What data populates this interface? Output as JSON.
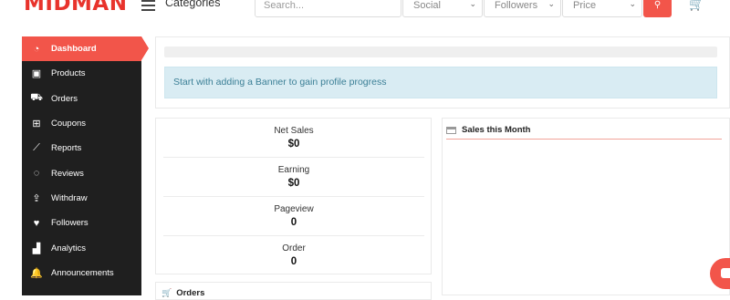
{
  "header": {
    "logo": "MIDMAN",
    "categories_label": "Categories",
    "search_placeholder": "Search...",
    "filters": [
      {
        "label": "Social"
      },
      {
        "label": "Followers"
      },
      {
        "label": "Price"
      }
    ],
    "search_icon": "search-icon",
    "cart_icon": "cart-icon"
  },
  "sidebar": {
    "items": [
      {
        "label": "Dashboard",
        "icon": "dashboard-icon",
        "active": true
      },
      {
        "label": "Products",
        "icon": "briefcase-icon"
      },
      {
        "label": "Orders",
        "icon": "cart-icon"
      },
      {
        "label": "Coupons",
        "icon": "gift-icon"
      },
      {
        "label": "Reports",
        "icon": "chart-line-icon"
      },
      {
        "label": "Reviews",
        "icon": "comments-icon"
      },
      {
        "label": "Withdraw",
        "icon": "upload-icon"
      },
      {
        "label": "Followers",
        "icon": "heart-icon"
      },
      {
        "label": "Analytics",
        "icon": "chart-area-icon"
      },
      {
        "label": "Announcements",
        "icon": "bell-icon"
      }
    ]
  },
  "profile_progress": {
    "progress": 0,
    "banner": "Start with adding a Banner to gain profile progress"
  },
  "stats": [
    {
      "label": "Net Sales",
      "value": "$0"
    },
    {
      "label": "Earning",
      "value": "$0"
    },
    {
      "label": "Pageview",
      "value": "0"
    },
    {
      "label": "Order",
      "value": "0"
    }
  ],
  "sales_panel": {
    "title": "Sales this Month"
  },
  "orders_panel": {
    "title": "Orders"
  },
  "colors": {
    "accent": "#f2554a",
    "sidebar_bg": "#1f1f1f",
    "info_bg": "#d9ecf3",
    "info_text": "#3b7f96"
  }
}
